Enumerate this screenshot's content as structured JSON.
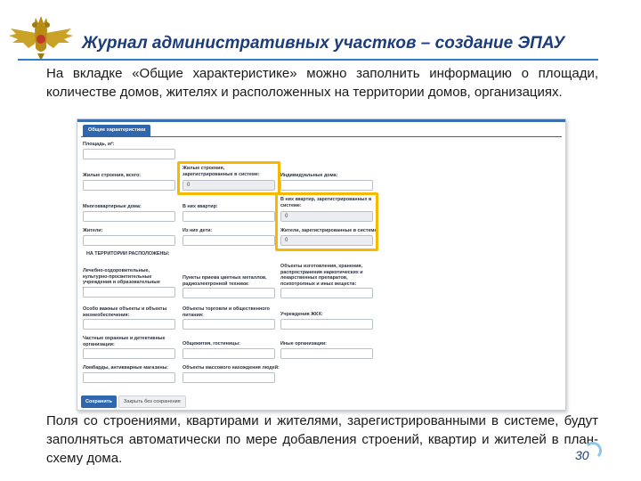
{
  "slide": {
    "title": "Журнал административных участков – создание ЭПАУ",
    "intro": "На вкладке «Общие характеристике» можно заполнить информацию о площади, количестве домов, жителях и расположенных на территории домов, организациях.",
    "outro": "Поля со строениями, квартирами и жителями, зарегистрированными в системе, будут заполняться автоматически по мере добавления строений, квартир и жителей в план-схему дома.",
    "page_number": "30"
  },
  "form": {
    "tab": "Общие характеристики",
    "area": "Площадь, м²:",
    "residential": "Жилые строения, всего:",
    "residential_registered": "Жилые строения, зарегистрированные в системе:",
    "individual_houses": "Индивидуальные дома:",
    "apartments_in_system": "В них квартир, зарегистрированных в системе:",
    "apartment_buildings": "Многоквартирные дома:",
    "apartments": "В них квартир:",
    "residents": "Жители:",
    "children": "Из них дети:",
    "residents_registered": "Жители, зарегистрированные в системе:",
    "territory_header": "НА ТЕРРИТОРИИ РАСПОЛОЖЕНЫ:",
    "medical": "Лечебно-оздоровительные, культурно-просветительные учреждения и образовательные учреждения:",
    "metals": "Пункты приема цветных металлов, радиоэлектронной техники:",
    "drugs": "Объекты изготовления, хранения, распространения наркотических и лекарственных препаратов, психотропных и иных веществ:",
    "important": "Особо важные объекты и объекты жизнеобеспечения:",
    "trade": "Объекты торговли и общественного питания:",
    "housing": "Учреждения ЖКХ:",
    "security": "Частные охранные и детективные организации:",
    "hostels": "Общежития, гостиницы:",
    "other": "Иные организации:",
    "pawnshops": "Ломбарды, антикварные магазины:",
    "mass": "Объекты массового нахождения людей:",
    "zero": "0",
    "save": "Сохранить",
    "close": "Закрыть без сохранения"
  }
}
